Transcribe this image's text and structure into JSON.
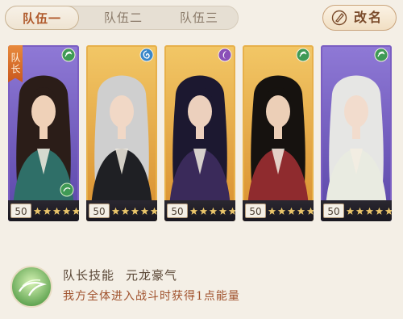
{
  "tabs": [
    {
      "label": "队伍一",
      "active": true
    },
    {
      "label": "队伍二",
      "active": false
    },
    {
      "label": "队伍三",
      "active": false
    }
  ],
  "rename_label": "改名",
  "captain_tag": "队长",
  "cards": [
    {
      "level": "50",
      "stars": 5,
      "element": "wind-icon",
      "frame": "purple",
      "robe": "#2f6f68",
      "skin": "#efd1b8",
      "hair": "#2b1d18"
    },
    {
      "level": "50",
      "stars": 5,
      "element": "water-swirl-icon",
      "frame": "gold",
      "robe": "#1f2024",
      "skin": "#f1d8c6",
      "hair": "#cfcfcf"
    },
    {
      "level": "50",
      "stars": 5,
      "element": "moon-icon",
      "frame": "gold",
      "robe": "#3a2a5a",
      "skin": "#ecd0bd",
      "hair": "#1c1830"
    },
    {
      "level": "50",
      "stars": 5,
      "element": "wind-icon",
      "frame": "gold",
      "robe": "#8f2b2e",
      "skin": "#eccfb7",
      "hair": "#16120f"
    },
    {
      "level": "50",
      "stars": 5,
      "element": "wind-icon",
      "frame": "purple",
      "robe": "#e9ebe1",
      "skin": "#f2dccd",
      "hair": "#e6e6e4"
    }
  ],
  "skill": {
    "title": "队长技能",
    "name": "元龙豪气",
    "description": "我方全体进入战斗时获得1点能量"
  },
  "colors": {
    "tab_active": "#b05a2c",
    "skill_desc": "#a0522d",
    "gold_frame": "#e7b04a",
    "purple_frame": "#7b5ec2"
  }
}
